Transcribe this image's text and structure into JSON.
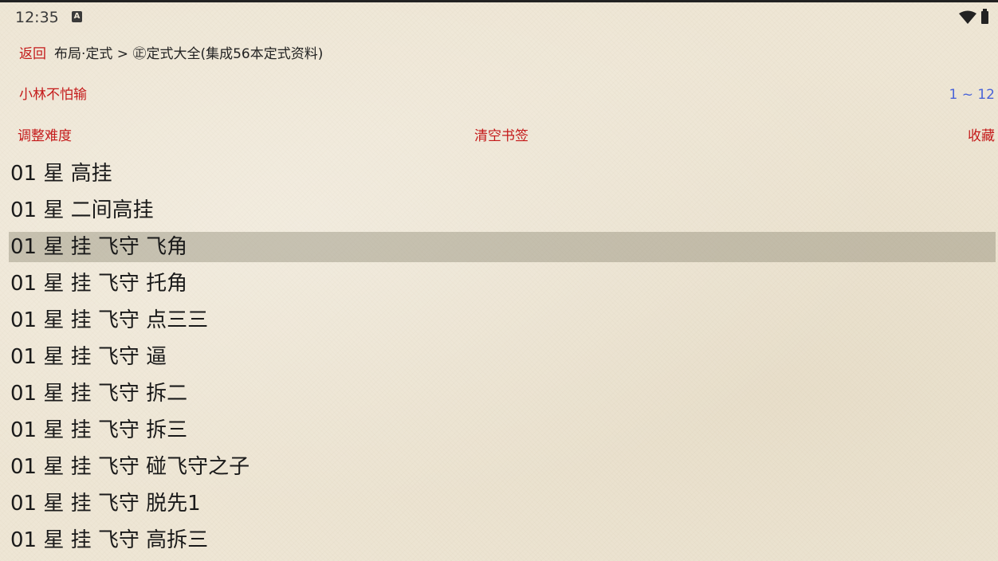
{
  "status_bar": {
    "time": "12:35",
    "notification_icon": "a-square-icon",
    "notification_glyph": "A",
    "wifi_icon": "wifi-icon",
    "battery_icon": "battery-icon"
  },
  "nav": {
    "back_label": "返回",
    "breadcrumb": "布局·定式 > ㊣定式大全(集成56本定式资料)"
  },
  "user": {
    "name": "小林不怕输"
  },
  "pagination": {
    "range": "1 ~ 12"
  },
  "toolbar": {
    "adjust_difficulty": "调整难度",
    "clear_bookmarks": "清空书签",
    "favorite": "收藏"
  },
  "list": {
    "selected_index": 2,
    "items": [
      "01 星 高挂",
      "01 星 二间高挂",
      "01 星 挂 飞守 飞角",
      "01 星 挂 飞守 托角",
      "01 星 挂 飞守 点三三",
      "01 星 挂 飞守 逼",
      "01 星 挂 飞守 拆二",
      "01 星 挂 飞守 拆三",
      "01 星 挂 飞守 碰飞守之子",
      "01 星 挂 飞守 脱先1",
      "01 星 挂 飞守 高拆三"
    ]
  },
  "colors": {
    "accent_red": "#c41a1a",
    "range_blue": "#4a64d8",
    "background": "#eee6d5",
    "selected_row": "#b5b09f"
  }
}
